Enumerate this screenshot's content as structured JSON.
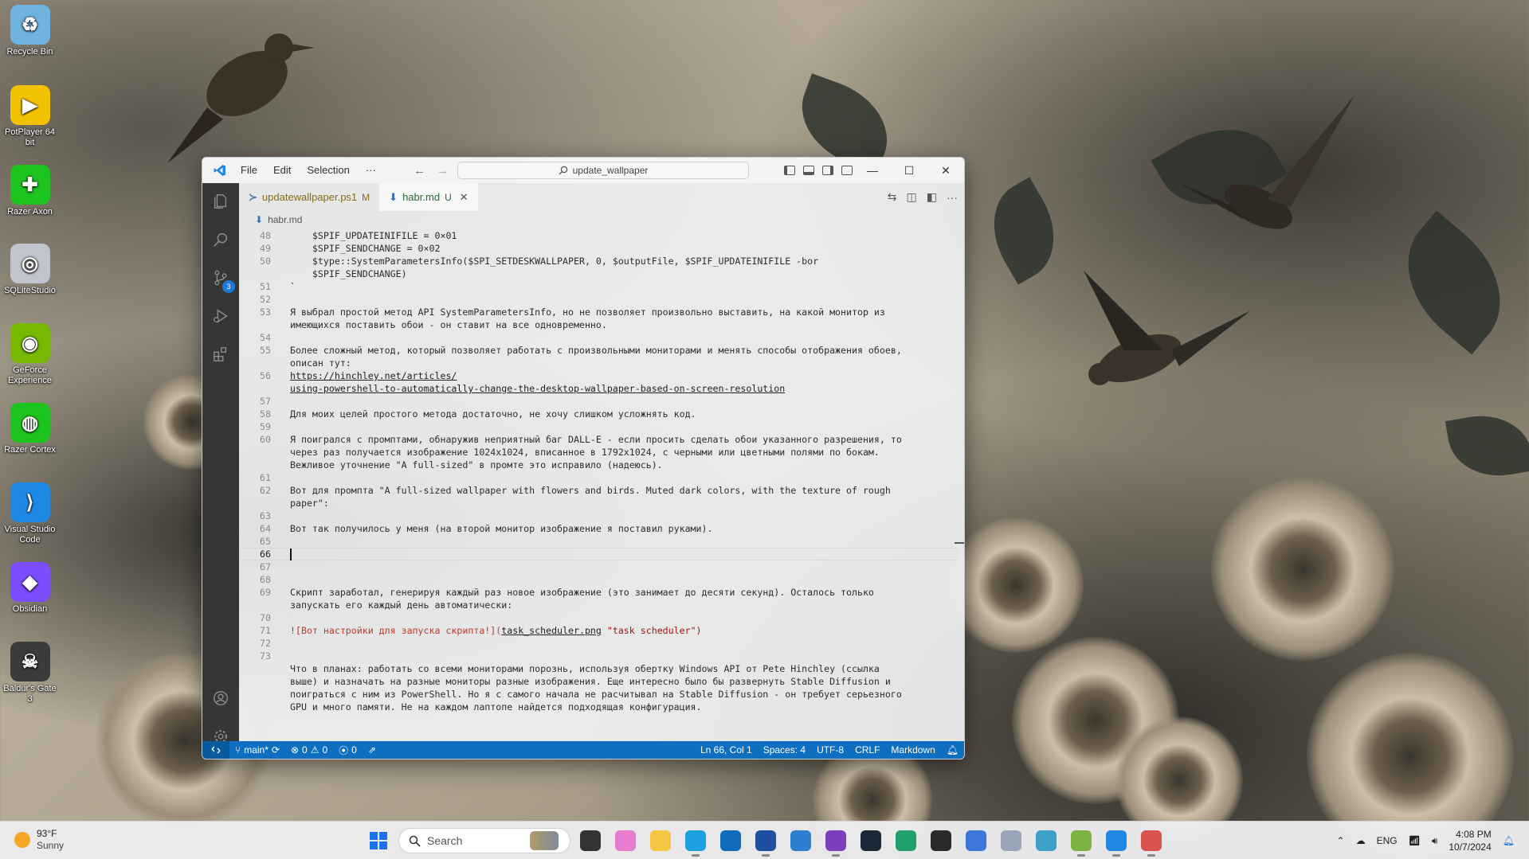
{
  "desktop": {
    "icons": [
      {
        "label": "Recycle Bin",
        "icon": "recycle-bin-icon",
        "color": "#6fb3e0",
        "glyph": "♻"
      },
      {
        "label": "PotPlayer 64 bit",
        "icon": "potplayer-icon",
        "color": "#f2c200",
        "glyph": "▶"
      },
      {
        "label": "Razer Axon",
        "icon": "razer-axon-icon",
        "color": "#1ec41e",
        "glyph": "✚"
      },
      {
        "label": "SQLiteStudio",
        "icon": "sqlitestudio-icon",
        "color": "#c0c4cc",
        "glyph": "◎"
      },
      {
        "label": "GeForce Experience",
        "icon": "geforce-experience-icon",
        "color": "#76b900",
        "glyph": "◉"
      },
      {
        "label": "Razer Cortex",
        "icon": "razer-cortex-icon",
        "color": "#1ec41e",
        "glyph": "◍"
      },
      {
        "label": "Visual Studio Code",
        "icon": "vscode-icon",
        "color": "#1e88e5",
        "glyph": "⟩"
      },
      {
        "label": "Obsidian",
        "icon": "obsidian-icon",
        "color": "#7c4dff",
        "glyph": "◆"
      },
      {
        "label": "Baldur's Gate 3",
        "icon": "baldurs-gate-icon",
        "color": "#3b3b3b",
        "glyph": "☠"
      }
    ]
  },
  "window": {
    "menu": [
      "File",
      "Edit",
      "Selection",
      "···"
    ],
    "command_center": "update_wallpaper",
    "tabs": [
      {
        "label": "updatewallpaper.ps1",
        "status": "M",
        "active": false
      },
      {
        "label": "habr.md",
        "status": "U",
        "active": true
      }
    ],
    "breadcrumb": "habr.md",
    "activity_badge": "3",
    "editor": {
      "gutter": [
        "48",
        "49",
        "50",
        "",
        "51",
        "52",
        "53",
        "",
        "54",
        "55",
        "",
        "56",
        "",
        "57",
        "58",
        "59",
        "60",
        "",
        "",
        "61",
        "62",
        "",
        "63",
        "64",
        "65",
        "66",
        "67",
        "68",
        "69",
        "",
        "70",
        "71",
        "72",
        "73",
        "",
        "",
        ""
      ],
      "lines": [
        "    $SPIF_UPDATEINIFILE = 0×01",
        "    $SPIF_SENDCHANGE = 0×02",
        "    $type::SystemParametersInfo($SPI_SETDESKWALLPAPER, 0, $outputFile, $SPIF_UPDATEINIFILE -bor",
        "    $SPIF_SENDCHANGE)",
        "`",
        "",
        "Я выбрал простой метод API SystemParametersInfo, но не позволяет произвольно выставить, на какой монитор из",
        "имеющихся поставить обои - он ставит на все одновременно.",
        "",
        "Более сложный метод, который позволяет работать с произвольными мониторами и менять способы отображения обоев,",
        "описан тут:",
        "https://hinchley.net/articles/",
        "using-powershell-to-automatically-change-the-desktop-wallpaper-based-on-screen-resolution",
        "",
        "Для моих целей простого метода достаточно, не хочу слишком усложнять код.",
        "",
        "Я поигрался с промптами, обнаружив неприятный баг DALL-E - если просить сделать обои указанного разрешения, то",
        "через раз получается изображение 1024x1024, вписанное в 1792x1024, с черными или цветными полями по бокам.",
        "Вежливое уточнение \"A full-sized\" в промте это исправило (надеюсь).",
        "",
        "Вот для промпта \"A full-sized wallpaper with flowers and birds. Muted dark colors, with the texture of rough",
        "paper\":",
        "",
        "Вот так получилось у меня (на второй монитор изображение я поставил руками).",
        "",
        "",
        "",
        "",
        "Скрипт заработал, генерируя каждый раз новое изображение (это занимает до десяти секунд). Осталось только",
        "запускать его каждый день автоматически:",
        "",
        "",
        "",
        "Что в планах: работать со всеми мониторами порознь, используя обертку Windows API от Pete Hinchley (ссылка",
        "выше) и назначать на разные мониторы разные изображения. Еще интересно было бы развернуть Stable Diffusion и",
        "поиграться с ним из PowerShell. Но я с самого начала не расчитывал на Stable Diffusion - он требует серьезного",
        "GPU и много памяти. Не на каждом лаптопе найдется подходящая конфигурация."
      ],
      "line71": {
        "prefix": "![Вот настройки для запуска скрипта!](",
        "link": "task_scheduler.png",
        "suffix": " \"task scheduler\")"
      }
    },
    "status": {
      "branch": "main*",
      "errors": "0",
      "warnings": "0",
      "ports": "0",
      "position": "Ln 66, Col 1",
      "spaces": "Spaces: 4",
      "encoding": "UTF-8",
      "eol": "CRLF",
      "language": "Markdown"
    }
  },
  "taskbar": {
    "weather_temp": "93°F",
    "weather_desc": "Sunny",
    "search_placeholder": "Search",
    "language": "ENG",
    "time": "4:08 PM",
    "date": "10/7/2024",
    "apps": [
      {
        "name": "task-view-icon",
        "color": "#333333",
        "running": false
      },
      {
        "name": "copilot-icon",
        "color": "#e87ccf",
        "running": false
      },
      {
        "name": "file-explorer-icon",
        "color": "#f4c542",
        "running": false
      },
      {
        "name": "edge-icon",
        "color": "#1ba1e2",
        "running": true
      },
      {
        "name": "outlook-icon",
        "color": "#0f6cbd",
        "running": false
      },
      {
        "name": "save-app-icon",
        "color": "#1e4fa0",
        "running": true
      },
      {
        "name": "app-b-icon",
        "color": "#2d7fd4",
        "running": false
      },
      {
        "name": "visual-studio-icon",
        "color": "#7e3fbf",
        "running": true
      },
      {
        "name": "steam-icon",
        "color": "#1b2838",
        "running": false
      },
      {
        "name": "app-grid-icon",
        "color": "#22a06b",
        "running": false
      },
      {
        "name": "terminal-icon",
        "color": "#2b2b2b",
        "running": false
      },
      {
        "name": "qbittorrent-icon",
        "color": "#3c78d8",
        "running": false
      },
      {
        "name": "sqlitestudio-taskbar-icon",
        "color": "#9aa5b8",
        "running": false
      },
      {
        "name": "app-k-icon",
        "color": "#3aa0c8",
        "running": false
      },
      {
        "name": "notepadpp-icon",
        "color": "#7cb342",
        "running": true
      },
      {
        "name": "vscode-taskbar-icon",
        "color": "#1e88e5",
        "running": true
      },
      {
        "name": "snipping-tool-icon",
        "color": "#d9534f",
        "running": true
      }
    ]
  }
}
